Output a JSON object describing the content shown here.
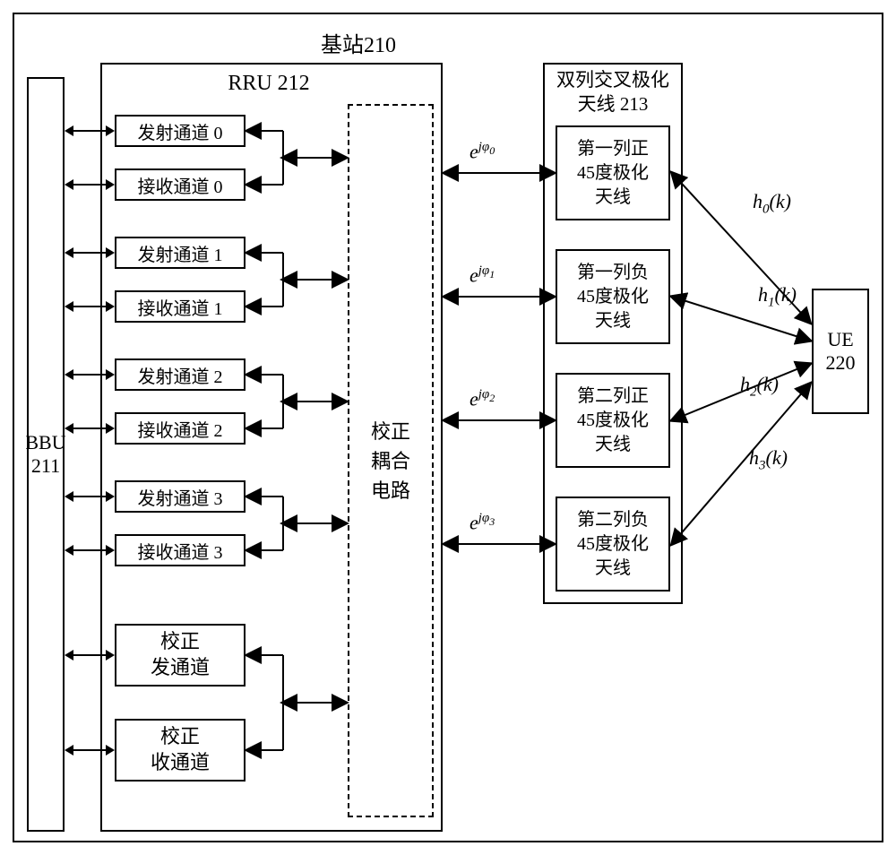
{
  "title": "基站210",
  "bbu": "BBU\n211",
  "rru": "RRU 212",
  "antenna_title": "双列交叉极化\n天线 213",
  "ue": "UE\n220",
  "channels": [
    {
      "tx": "发射通道 0",
      "rx": "接收通道 0",
      "phi": "e^{jφ_0}",
      "ant": "第一列正\n45度极化\n天线",
      "h": "h₀(k)"
    },
    {
      "tx": "发射通道 1",
      "rx": "接收通道 1",
      "phi": "e^{jφ_1}",
      "ant": "第一列负\n45度极化\n天线",
      "h": "h₁(k)"
    },
    {
      "tx": "发射通道 2",
      "rx": "接收通道 2",
      "phi": "e^{jφ_2}",
      "ant": "第二列正\n45度极化\n天线",
      "h": "h₂(k)"
    },
    {
      "tx": "发射通道 3",
      "rx": "接收通道 3",
      "phi": "e^{jφ_3}",
      "ant": "第二列负\n45度极化\n天线",
      "h": "h₃(k)"
    }
  ],
  "cal_tx": "校正\n发通道",
  "cal_rx": "校正\n收通道",
  "cal_circuit": "校正\n耦合\n电路",
  "chart_data": {
    "type": "block-diagram",
    "title": "基站210 architecture with RRU 212, dual-column cross-polarized antenna 213, and UE 220",
    "blocks": {
      "BBU": "211",
      "RRU": "212",
      "antenna_array": "双列交叉极化天线 213",
      "UE": "220",
      "channels": [
        {
          "index": 0,
          "tx": "发射通道 0",
          "rx": "接收通道 0",
          "phase": "e^{jφ_0}",
          "antenna": "第一列正45度极化天线",
          "channel_response": "h_0(k)"
        },
        {
          "index": 1,
          "tx": "发射通道 1",
          "rx": "接收通道 1",
          "phase": "e^{jφ_1}",
          "antenna": "第一列负45度极化天线",
          "channel_response": "h_1(k)"
        },
        {
          "index": 2,
          "tx": "发射通道 2",
          "rx": "接收通道 2",
          "phase": "e^{jφ_2}",
          "antenna": "第二列正45度极化天线",
          "channel_response": "h_2(k)"
        },
        {
          "index": 3,
          "tx": "发射通道 3",
          "rx": "接收通道 3",
          "phase": "e^{jφ_3}",
          "antenna": "第二列负45度极化天线",
          "channel_response": "h_3(k)"
        }
      ],
      "calibration": {
        "tx": "校正发通道",
        "rx": "校正收通道",
        "circuit": "校正耦合电路"
      }
    },
    "connections": [
      "BBU ↔ each TX/RX channel and calibration channels (bidirectional)",
      "Each TX/RX pair ↔ 校正耦合电路 (bidirectional)",
      "校正耦合电路 ↔ antenna column i via phase e^{jφ_i} (bidirectional), i=0..3",
      "Antenna column i ↔ UE via h_i(k) (bidirectional), i=0..3"
    ]
  }
}
